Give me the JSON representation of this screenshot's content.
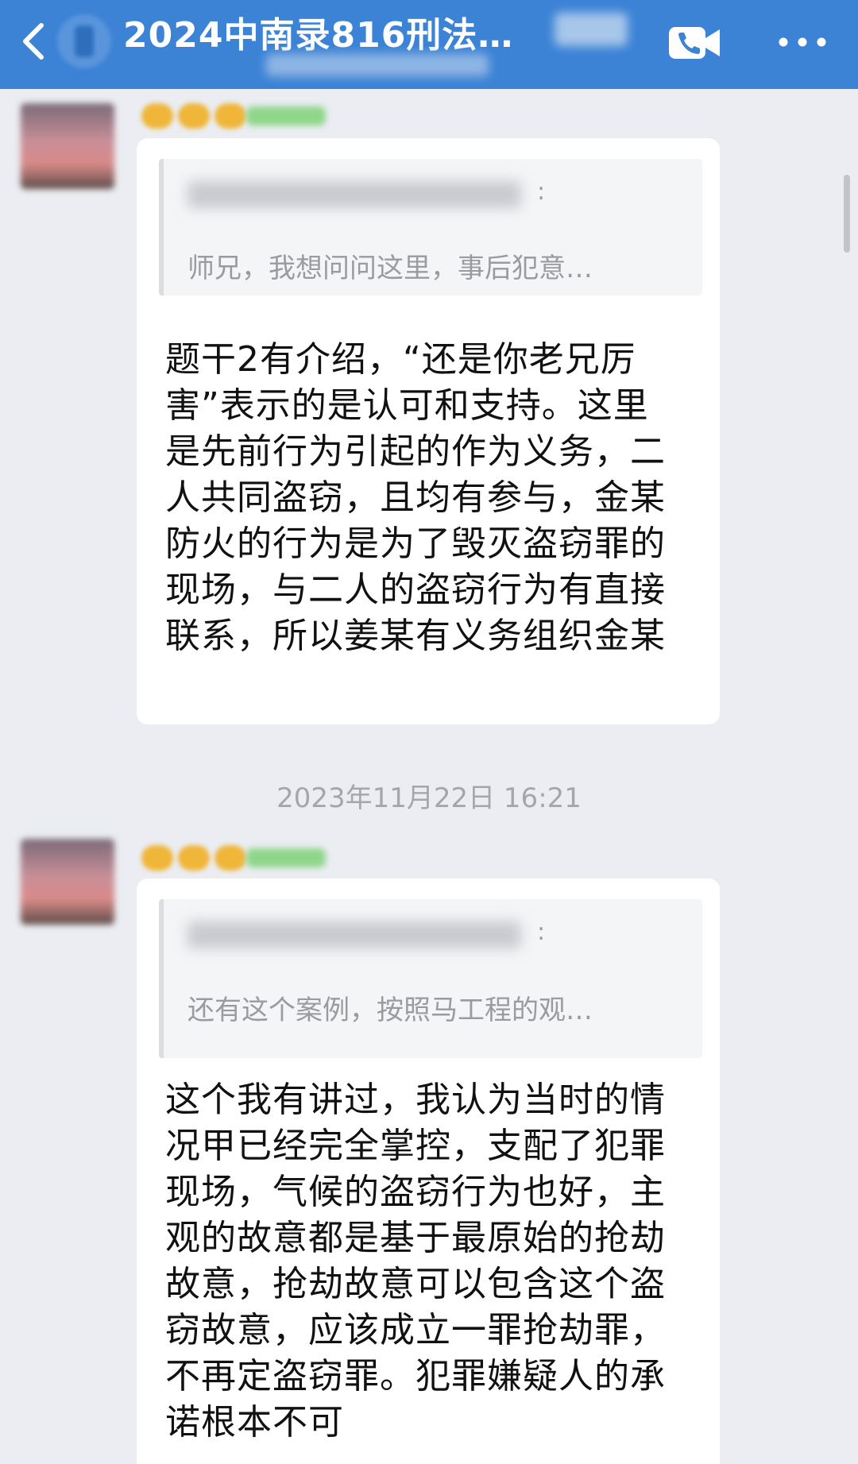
{
  "header": {
    "title": "2024中南录816刑法…",
    "back_icon": "chevron-left-icon",
    "video_icon": "video-call-icon",
    "more_icon": "more-dots-icon",
    "background": "#3c83d6"
  },
  "messages": [
    {
      "quote": {
        "text": "师兄，我想问问这里，事后犯意…"
      },
      "text": "题干2有介绍，“还是你老兄厉害”表示的是认可和支持。这里是先前行为引起的作为义务，二人共同盗窃，且均有参与，金某防火的行为是为了毁灭盗窃罪的现场，与二人的盗窃行为有直接联系，所以姜某有义务组织金某"
    },
    {
      "quote": {
        "text": "还有这个案例，按照马工程的观…"
      },
      "text": "这个我有讲过，我认为当时的情况甲已经完全掌控，支配了犯罪现场，气候的盗窃行为也好，主观的故意都是基于最原始的抢劫故意，抢劫故意可以包含这个盗窃故意，应该成立一罪抢劫罪，不再定盗窃罪。犯罪嫌疑人的承诺根本不可"
    }
  ],
  "timestamp": "2023年11月22日 16:21"
}
